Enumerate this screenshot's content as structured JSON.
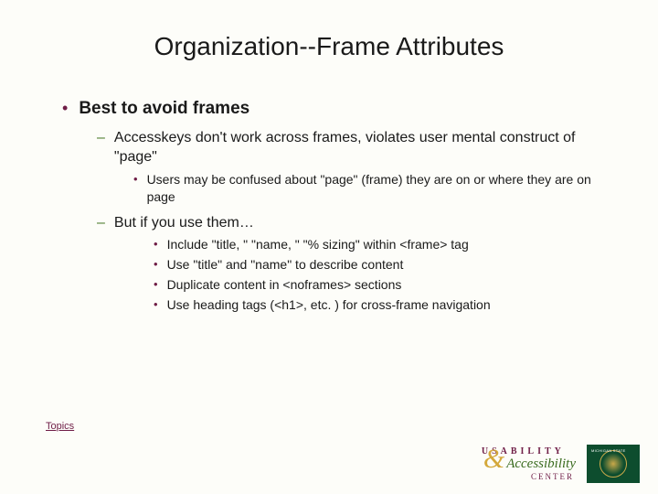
{
  "title": "Organization--Frame Attributes",
  "bullets": {
    "l1": "Best to avoid frames",
    "l2a": "Accesskeys don't work across frames, violates user mental construct of \"page\"",
    "l3a": "Users may be confused about \"page\" (frame) they are on or where they are on page",
    "l2b": "But if you use them…",
    "l4a": "Include \"title, \" \"name, \" \"% sizing\" within <frame> tag",
    "l4b": "Use \"title\" and \"name\" to describe content",
    "l4c": "Duplicate content in <noframes> sections",
    "l4d": "Use heading tags (<h1>, etc. ) for cross-frame navigation"
  },
  "topics_link": "Topics",
  "footer": {
    "usability": "USABILITY",
    "accessibility": "Accessibility",
    "center": "CENTER",
    "msu": "MICHIGAN STATE"
  }
}
